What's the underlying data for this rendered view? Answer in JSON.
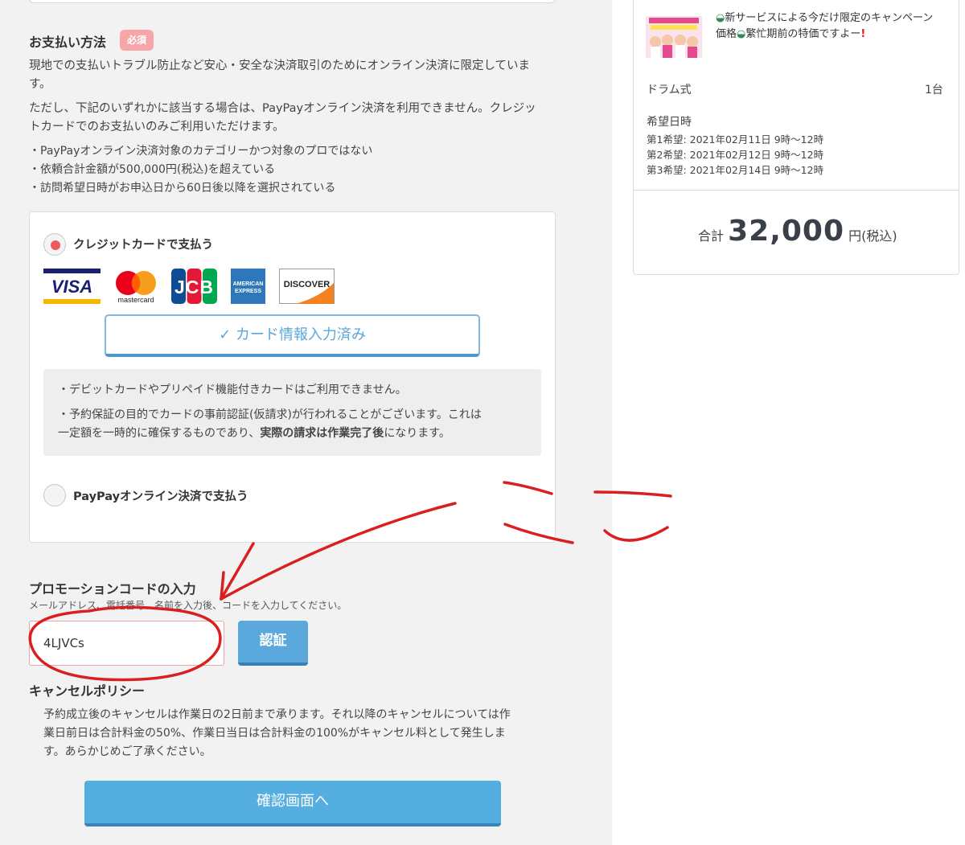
{
  "payment": {
    "heading": "お支払い方法",
    "required_badge": "必須",
    "para1_line1": "現地での支払いトラブル防止など安心・安全な決済取引のためにオンライン決済に限定していま",
    "para1_line2": "す。",
    "para2_line1": "ただし、下記のいずれかに該当する場合は、PayPayオンライン決済を利用できません。クレジッ",
    "para2_line2": "トカードでのお支払いのみご利用いただけます。",
    "conditions": [
      "・PayPayオンライン決済対象のカテゴリーかつ対象のプロではない",
      "・依頼合計金額が500,000円(税込)を超えている",
      "・訪問希望日時がお申込日から60日後以降を選択されている"
    ],
    "credit_option_label": "クレジットカードで支払う",
    "card_brands": [
      "VISA",
      "mastercard",
      "JCB",
      "AMERICAN EXPRESS",
      "DISCOVER"
    ],
    "card_filled_label": "✓ カード情報入力済み",
    "notice1": "・デビットカードやプリペイド機能付きカードはご利用できません。",
    "notice2_line1": "・予約保証の目的でカードの事前認証(仮請求)が行われることがございます。これは",
    "notice2_line2_a": "一定額を一時的に確保するものであり、",
    "notice2_line2_b": "実際の請求は作業完了後",
    "notice2_line2_c": "になります。",
    "paypay_option_label": "PayPayオンライン決済で支払う",
    "selected": "credit"
  },
  "promo": {
    "heading": "プロモーションコードの入力",
    "hint": "メールアドレス、電話番号、名前を入力後、コードを入力してください。",
    "value": "4LJVCs",
    "button": "認証"
  },
  "cancel": {
    "heading": "キャンセルポリシー",
    "line1": "予約成立後のキャンセルは作業日の2日前まで承ります。それ以降のキャンセルについては作",
    "line2": "業日前日は合計料金の50%、作業日当日は合計料金の100%がキャンセル料として発生しま",
    "line3": "す。あらかじめご了承ください。"
  },
  "confirm_button": "確認画面へ",
  "summary": {
    "campaign_line1": "新サービスによる今だけ限定のキャンペーン",
    "campaign_line2_a": "価格",
    "campaign_line2_b": "繁忙期前の特価ですよー",
    "item_name": "ドラム式",
    "item_qty": "1台",
    "pref_title": "希望日時",
    "prefs": [
      "第1希望: 2021年02月11日 9時〜12時",
      "第2希望: 2021年02月12日 9時〜12時",
      "第3希望: 2021年02月14日 9時〜12時"
    ],
    "total_label": "合計",
    "total_amount": "32,000",
    "total_unit": "円(税込)"
  },
  "annotation": {
    "handwritten_text": "ここ",
    "color": "#d91f1f"
  },
  "colors": {
    "accent_blue": "#55aee0",
    "required_pink": "#f6a5a8",
    "radio_selected": "#ee5a5a"
  }
}
